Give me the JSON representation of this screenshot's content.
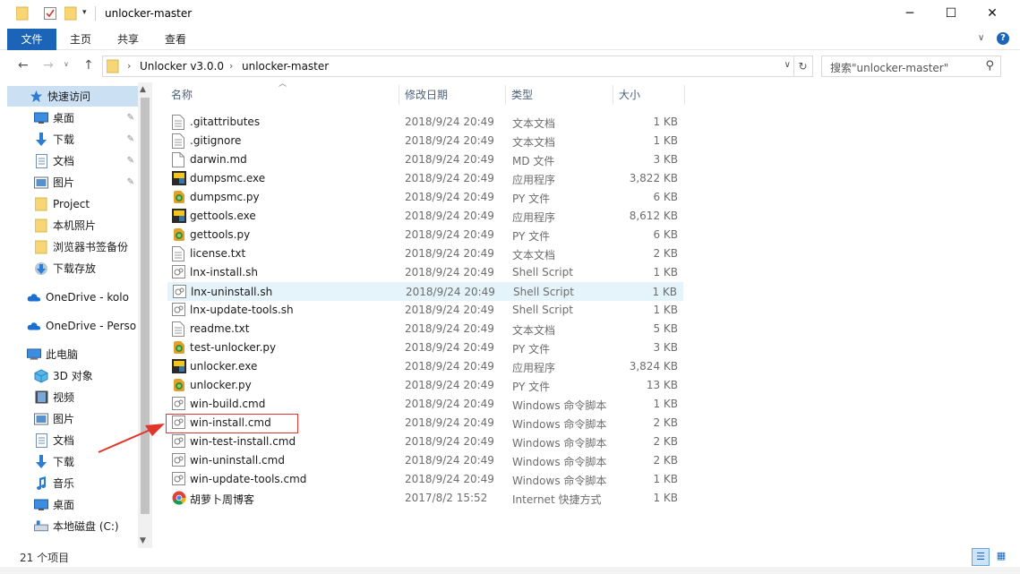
{
  "window": {
    "title": "unlocker-master",
    "minimize": "─",
    "maximize": "☐",
    "close": "✕"
  },
  "ribbon": {
    "tabs": [
      "文件",
      "主页",
      "共享",
      "查看"
    ],
    "expand": "∨",
    "help": "?"
  },
  "address": {
    "crumbs": [
      "Unlocker v3.0.0",
      "unlocker-master"
    ],
    "search_placeholder": "搜索\"unlocker-master\""
  },
  "nav": {
    "items": [
      {
        "label": "快速访问",
        "icon": "star-icon",
        "pinned": false
      },
      {
        "label": "桌面",
        "icon": "desktop-icon",
        "pinned": true
      },
      {
        "label": "下载",
        "icon": "download-icon",
        "pinned": true
      },
      {
        "label": "文档",
        "icon": "document-icon",
        "pinned": true
      },
      {
        "label": "图片",
        "icon": "pictures-icon",
        "pinned": true
      },
      {
        "label": "Project",
        "icon": "folder-icon",
        "pinned": false
      },
      {
        "label": "本机照片",
        "icon": "folder-icon",
        "pinned": false
      },
      {
        "label": "浏览器书签备份",
        "icon": "folder-icon",
        "pinned": false
      },
      {
        "label": "下载存放",
        "icon": "download-folder-icon",
        "pinned": false
      },
      {
        "label": "OneDrive - kolo",
        "icon": "onedrive-icon",
        "pinned": false
      },
      {
        "label": "OneDrive - Perso",
        "icon": "onedrive-icon",
        "pinned": false
      },
      {
        "label": "此电脑",
        "icon": "computer-icon",
        "pinned": false
      },
      {
        "label": "3D 对象",
        "icon": "3d-objects-icon",
        "pinned": false
      },
      {
        "label": "视频",
        "icon": "video-icon",
        "pinned": false
      },
      {
        "label": "图片",
        "icon": "pictures-icon",
        "pinned": false
      },
      {
        "label": "文档",
        "icon": "document-icon",
        "pinned": false
      },
      {
        "label": "下载",
        "icon": "download-icon",
        "pinned": false
      },
      {
        "label": "音乐",
        "icon": "music-icon",
        "pinned": false
      },
      {
        "label": "桌面",
        "icon": "desktop-icon",
        "pinned": false
      },
      {
        "label": "本地磁盘 (C:)",
        "icon": "drive-icon",
        "pinned": false
      }
    ]
  },
  "columns": {
    "name": "名称",
    "date": "修改日期",
    "type": "类型",
    "size": "大小"
  },
  "files": [
    {
      "name": ".gitattributes",
      "date": "2018/9/24 20:49",
      "type": "文本文档",
      "size": "1 KB",
      "icon": "text-file-icon"
    },
    {
      "name": ".gitignore",
      "date": "2018/9/24 20:49",
      "type": "文本文档",
      "size": "1 KB",
      "icon": "text-file-icon"
    },
    {
      "name": "darwin.md",
      "date": "2018/9/24 20:49",
      "type": "MD 文件",
      "size": "3 KB",
      "icon": "blank-file-icon"
    },
    {
      "name": "dumpsmc.exe",
      "date": "2018/9/24 20:49",
      "type": "应用程序",
      "size": "3,822 KB",
      "icon": "python-exe-icon"
    },
    {
      "name": "dumpsmc.py",
      "date": "2018/9/24 20:49",
      "type": "PY 文件",
      "size": "6 KB",
      "icon": "python-file-icon"
    },
    {
      "name": "gettools.exe",
      "date": "2018/9/24 20:49",
      "type": "应用程序",
      "size": "8,612 KB",
      "icon": "python-exe-icon"
    },
    {
      "name": "gettools.py",
      "date": "2018/9/24 20:49",
      "type": "PY 文件",
      "size": "6 KB",
      "icon": "python-file-icon"
    },
    {
      "name": "license.txt",
      "date": "2018/9/24 20:49",
      "type": "文本文档",
      "size": "2 KB",
      "icon": "text-file-icon"
    },
    {
      "name": "lnx-install.sh",
      "date": "2018/9/24 20:49",
      "type": "Shell Script",
      "size": "1 KB",
      "icon": "script-icon"
    },
    {
      "name": "lnx-uninstall.sh",
      "date": "2018/9/24 20:49",
      "type": "Shell Script",
      "size": "1 KB",
      "icon": "script-icon"
    },
    {
      "name": "lnx-update-tools.sh",
      "date": "2018/9/24 20:49",
      "type": "Shell Script",
      "size": "1 KB",
      "icon": "script-icon"
    },
    {
      "name": "readme.txt",
      "date": "2018/9/24 20:49",
      "type": "文本文档",
      "size": "5 KB",
      "icon": "text-file-icon"
    },
    {
      "name": "test-unlocker.py",
      "date": "2018/9/24 20:49",
      "type": "PY 文件",
      "size": "3 KB",
      "icon": "python-file-icon"
    },
    {
      "name": "unlocker.exe",
      "date": "2018/9/24 20:49",
      "type": "应用程序",
      "size": "3,824 KB",
      "icon": "python-exe-icon"
    },
    {
      "name": "unlocker.py",
      "date": "2018/9/24 20:49",
      "type": "PY 文件",
      "size": "13 KB",
      "icon": "python-file-icon"
    },
    {
      "name": "win-build.cmd",
      "date": "2018/9/24 20:49",
      "type": "Windows 命令脚本",
      "size": "1 KB",
      "icon": "script-icon"
    },
    {
      "name": "win-install.cmd",
      "date": "2018/9/24 20:49",
      "type": "Windows 命令脚本",
      "size": "2 KB",
      "icon": "script-icon"
    },
    {
      "name": "win-test-install.cmd",
      "date": "2018/9/24 20:49",
      "type": "Windows 命令脚本",
      "size": "2 KB",
      "icon": "script-icon"
    },
    {
      "name": "win-uninstall.cmd",
      "date": "2018/9/24 20:49",
      "type": "Windows 命令脚本",
      "size": "2 KB",
      "icon": "script-icon"
    },
    {
      "name": "win-update-tools.cmd",
      "date": "2018/9/24 20:49",
      "type": "Windows 命令脚本",
      "size": "1 KB",
      "icon": "script-icon"
    },
    {
      "name": "胡萝卜周博客",
      "date": "2017/8/2 15:52",
      "type": "Internet 快捷方式",
      "size": "1 KB",
      "icon": "chrome-shortcut-icon"
    }
  ],
  "status": {
    "count": "21 个项目"
  },
  "colors": {
    "accent": "#1b64b7",
    "selected": "#cce0f4",
    "hover_row": "#e5f3fb",
    "annotation": "#e0362b"
  }
}
